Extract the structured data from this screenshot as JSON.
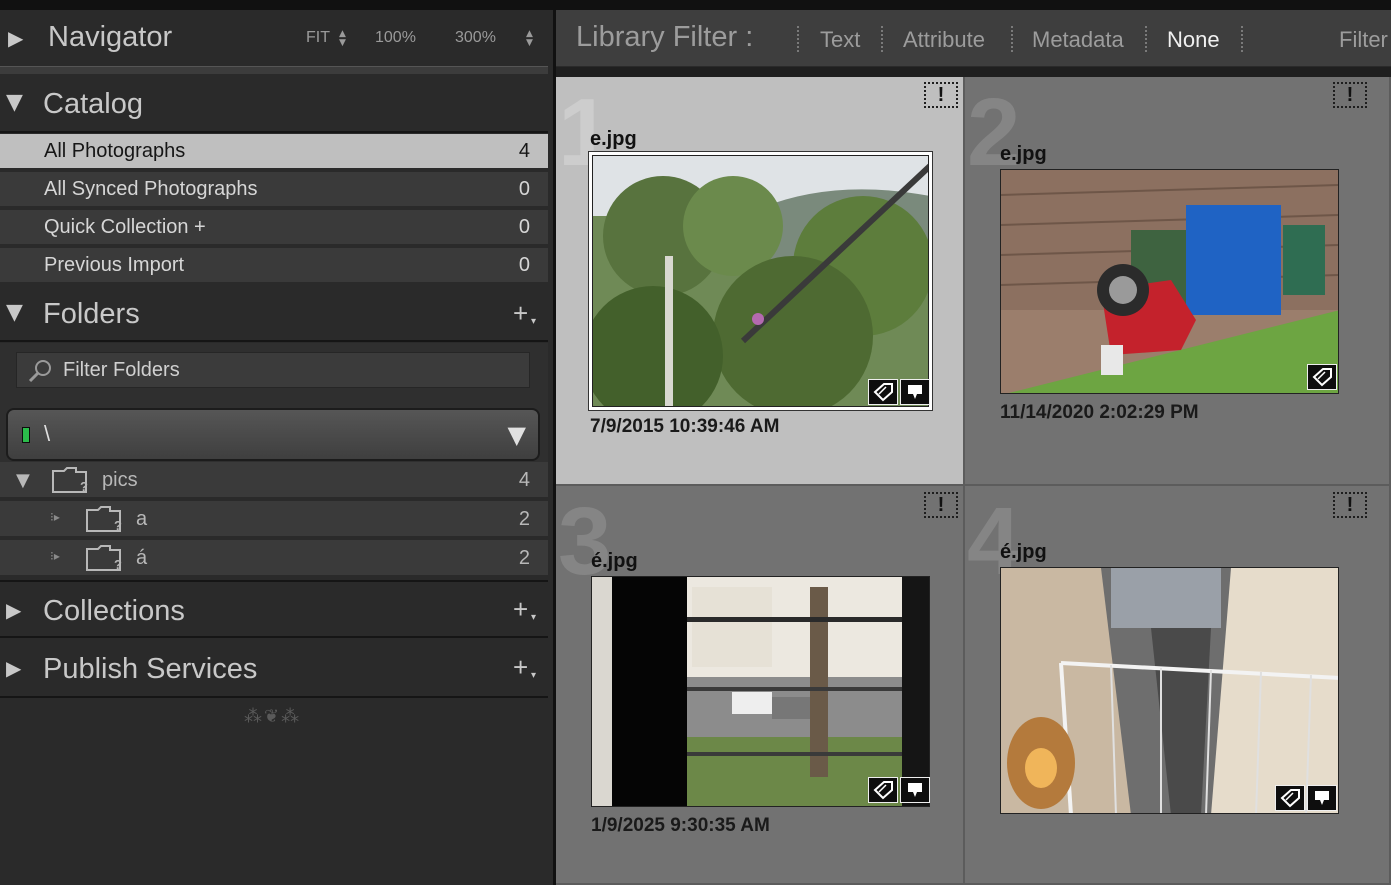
{
  "navigator": {
    "title": "Navigator",
    "zoom_fit": "FIT",
    "zoom_100": "100%",
    "zoom_300": "300%"
  },
  "catalog": {
    "title": "Catalog",
    "items": [
      {
        "label": "All Photographs",
        "count": "4",
        "selected": true
      },
      {
        "label": "All Synced Photographs",
        "count": "0"
      },
      {
        "label": "Quick Collection  +",
        "count": "0"
      },
      {
        "label": "Previous Import",
        "count": "0"
      }
    ]
  },
  "folders": {
    "title": "Folders",
    "filter_placeholder": "Filter Folders",
    "volume_path": "\\",
    "tree": [
      {
        "label": "pics",
        "count": "4"
      },
      {
        "label": "a",
        "count": "2"
      },
      {
        "label": "á",
        "count": "2"
      }
    ]
  },
  "collections": {
    "title": "Collections"
  },
  "publish": {
    "title": "Publish Services"
  },
  "library_filter": {
    "title": "Library Filter :",
    "options": [
      "Text",
      "Attribute",
      "Metadata",
      "None"
    ],
    "active": "None",
    "filters_label": "Filter"
  },
  "grid": {
    "cells": [
      {
        "index": "1",
        "filename": "e.jpg",
        "date": "7/9/2015 10:39:46 AM",
        "selected": true
      },
      {
        "index": "2",
        "filename": "e.jpg",
        "date": "11/14/2020 2:02:29 PM"
      },
      {
        "index": "3",
        "filename": "é.jpg",
        "date": "1/9/2025 9:30:35 AM"
      },
      {
        "index": "4",
        "filename": "é.jpg",
        "date": ""
      }
    ],
    "warning_symbol": "!"
  },
  "colors": {
    "panel_bg": "#2a2a2a",
    "row_bg": "#3a3a3a",
    "selected_bg": "#bfbfbf",
    "grid_bg": "#727272",
    "volume_indicator": "#2bbd4b"
  }
}
